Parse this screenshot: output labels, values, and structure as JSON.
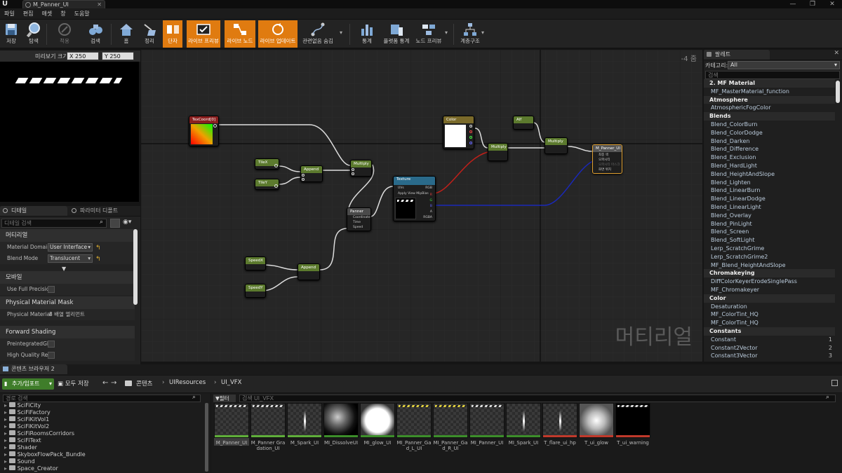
{
  "window": {
    "doc_tab": "M_Panner_UI"
  },
  "menu": [
    "파일",
    "편집",
    "애셋",
    "창",
    "도움말"
  ],
  "toolbar": {
    "save": "저장",
    "browse": "탐색",
    "apply": "적용",
    "search": "검색",
    "home": "홈",
    "clean_up": "정리",
    "connectors": "단자",
    "live_preview": "라이브 프리뷰",
    "live_nodes": "라이브 노드",
    "live_update": "라이브 업데이트",
    "hide_unrelated": "관련없음 숨김",
    "stats": "통계",
    "platform_stats": "플랫폼 통계",
    "node_preview": "노드 프리뷰",
    "hierarchy": "계층구조"
  },
  "preview": {
    "size_label": "미리보기 크기",
    "x_value": "X 250",
    "y_value": "Y 250"
  },
  "details": {
    "tab_details": "디테일",
    "tab_params": "파라미터 디폴트",
    "search_placeholder": "디테일 검색",
    "cat_material": "머티리얼",
    "material_domain_label": "Material Domain",
    "material_domain_value": "User Interface",
    "blend_mode_label": "Blend Mode",
    "blend_mode_value": "Translucent",
    "cat_mobile": "모바일",
    "use_full_precision": "Use Full Precision",
    "cat_phys_mask": "Physical Material Mask",
    "phys_material_label": "Physical Material",
    "phys_material_value": "8 배열 엘리먼트",
    "cat_forward": "Forward Shading",
    "preintegrated": "PreintegratedGF F",
    "high_quality": "High Quality Refle"
  },
  "graph": {
    "zoom": "-4 줌",
    "watermark": "머티리얼",
    "nodes": {
      "texcoord": "TexCoord[0]",
      "tilex": "TileX",
      "tiley": "TileY",
      "append1": "Append",
      "multiply1": "Multiply",
      "panner": "Panner",
      "panner_pins": [
        "Coordinate",
        "Time",
        "Speed"
      ],
      "speedx": "SpeedX",
      "speedy": "SpeedY",
      "append2": "Append",
      "texture": "Texture",
      "texture_sub": "Param2D",
      "texture_pins_in": [
        "UVs",
        "Apply View MipBias"
      ],
      "texture_pins_out": [
        "RGB",
        "R",
        "G",
        "B",
        "A",
        "RGBA"
      ],
      "color": "Color",
      "color_sub": "Param (1,1,1,1)",
      "multiply2": "Multiply",
      "alpha": "Alf",
      "multiply3": "Multiply",
      "result": "M_Panner_UI",
      "result_pins": [
        "최종 색",
        "오파시티",
        "오파시티 마스크",
        "화면 위치"
      ]
    }
  },
  "palette": {
    "tab": "팔레트",
    "category_label": "카테고리:",
    "category_value": "All",
    "search_placeholder": "검색",
    "rows": [
      {
        "t": "cat",
        "text": "2. MF Material"
      },
      {
        "t": "item",
        "text": "MF_MasterMaterial_function"
      },
      {
        "t": "cat",
        "text": "Atmosphere"
      },
      {
        "t": "item",
        "text": "AtmosphericFogColor"
      },
      {
        "t": "cat",
        "text": "Blends"
      },
      {
        "t": "item",
        "text": "Blend_ColorBurn"
      },
      {
        "t": "item",
        "text": "Blend_ColorDodge"
      },
      {
        "t": "item",
        "text": "Blend_Darken"
      },
      {
        "t": "item",
        "text": "Blend_Difference"
      },
      {
        "t": "item",
        "text": "Blend_Exclusion"
      },
      {
        "t": "item",
        "text": "Blend_HardLight"
      },
      {
        "t": "item",
        "text": "Blend_HeightAndSlope"
      },
      {
        "t": "item",
        "text": "Blend_Lighten"
      },
      {
        "t": "item",
        "text": "Blend_LinearBurn"
      },
      {
        "t": "item",
        "text": "Blend_LinearDodge"
      },
      {
        "t": "item",
        "text": "Blend_LinearLight"
      },
      {
        "t": "item",
        "text": "Blend_Overlay"
      },
      {
        "t": "item",
        "text": "Blend_PinLight"
      },
      {
        "t": "item",
        "text": "Blend_Screen"
      },
      {
        "t": "item",
        "text": "Blend_SoftLight"
      },
      {
        "t": "item",
        "text": "Lerp_ScratchGrime"
      },
      {
        "t": "item",
        "text": "Lerp_ScratchGrime2"
      },
      {
        "t": "item",
        "text": "MF_Blend_HeightAndSlope"
      },
      {
        "t": "cat",
        "text": "Chromakeying"
      },
      {
        "t": "item",
        "text": "DiffColorKeyerErodeSinglePass"
      },
      {
        "t": "item",
        "text": "MF_Chromakeyer"
      },
      {
        "t": "cat",
        "text": "Color"
      },
      {
        "t": "item",
        "text": "Desaturation"
      },
      {
        "t": "item",
        "text": "MF_ColorTint_HQ"
      },
      {
        "t": "item",
        "text": "MF_ColorTint_HQ"
      },
      {
        "t": "cat",
        "text": "Constants"
      },
      {
        "t": "item",
        "text": "Constant",
        "num": "1"
      },
      {
        "t": "item",
        "text": "Constant2Vector",
        "num": "2"
      },
      {
        "t": "item",
        "text": "Constant3Vector",
        "num": "3"
      }
    ]
  },
  "content_browser": {
    "tab": "콘텐츠 브라우저 2",
    "add_import": "추가/임포트",
    "save_all": "모두 저장",
    "path": [
      "콘텐츠",
      "UIResources",
      "UI_VFX"
    ],
    "folder_search_placeholder": "경로 검색",
    "filter": "필터",
    "asset_search_placeholder": "검색 UI_VFX",
    "folders": [
      "SciFiCity",
      "SciFiFactory",
      "SciFiKitVol1",
      "SciFiKitVol2",
      "SciFiRoomsCorridors",
      "SciFiText",
      "Shader",
      "SkyboxFlowPack_Bundle",
      "Sound",
      "Space_Creator"
    ],
    "assets": [
      {
        "name": "M_Panner_UI",
        "kind": "material"
      },
      {
        "name": "M_Panner Gradation_UI",
        "kind": "material"
      },
      {
        "name": "M_Spark_UI",
        "kind": "material"
      },
      {
        "name": "MI_DissolveUI",
        "kind": "instance"
      },
      {
        "name": "MI_glow_UI",
        "kind": "instance"
      },
      {
        "name": "MI_Panner_Gad_L_UI",
        "kind": "instance"
      },
      {
        "name": "MI_Panner_Gad_R_UI",
        "kind": "instance"
      },
      {
        "name": "MI_Panner_UI",
        "kind": "instance"
      },
      {
        "name": "MI_Spark_UI",
        "kind": "instance"
      },
      {
        "name": "T_flare_ui_hp",
        "kind": "texture"
      },
      {
        "name": "T_ui_glow",
        "kind": "texture"
      },
      {
        "name": "T_ui_warning",
        "kind": "texture"
      }
    ]
  },
  "colors": {
    "accent_orange": "#e07b10",
    "material_bar": "#5fae3a",
    "instance_bar": "#3c8e2a",
    "texture_bar": "#c0392b",
    "add_button": "#3f7d2a"
  }
}
